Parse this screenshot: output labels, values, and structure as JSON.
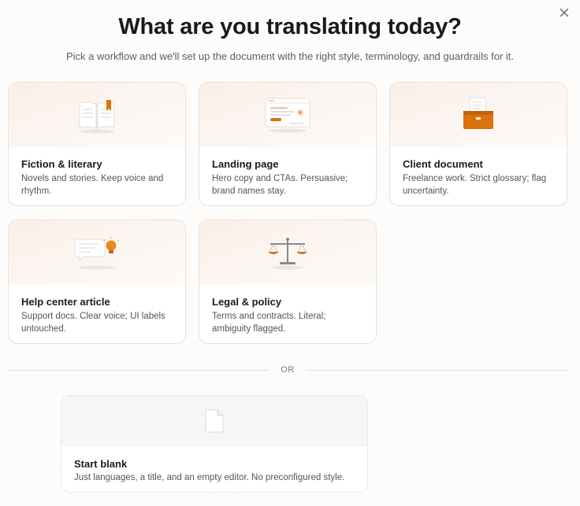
{
  "header": {
    "title": "What are you translating today?",
    "subtitle": "Pick a workflow and we'll set up the document with the right style, terminology, and guardrails for it."
  },
  "icons": {
    "close": "close-icon",
    "fiction": "open-book-icon",
    "landing": "browser-window-icon",
    "client": "briefcase-document-icon",
    "help": "speech-bubble-lightbulb-icon",
    "legal": "balance-scale-icon",
    "blank": "blank-page-icon"
  },
  "colors": {
    "accent": "#d9730d",
    "card_border": "#e5e2df",
    "art_gradient_start": "#fbefe7"
  },
  "workflows": [
    {
      "title": "Fiction & literary",
      "description": "Novels and stories. Keep voice and rhythm."
    },
    {
      "title": "Landing page",
      "description": "Hero copy and CTAs. Persuasive; brand names stay."
    },
    {
      "title": "Client document",
      "description": "Freelance work. Strict glossary; flag uncertainty."
    },
    {
      "title": "Help center article",
      "description": "Support docs. Clear voice; UI labels untouched."
    },
    {
      "title": "Legal & policy",
      "description": "Terms and contracts. Literal; ambiguity flagged."
    }
  ],
  "divider": {
    "label": "OR"
  },
  "blank": {
    "title": "Start blank",
    "description": "Just languages, a title, and an empty editor. No preconfigured style."
  }
}
